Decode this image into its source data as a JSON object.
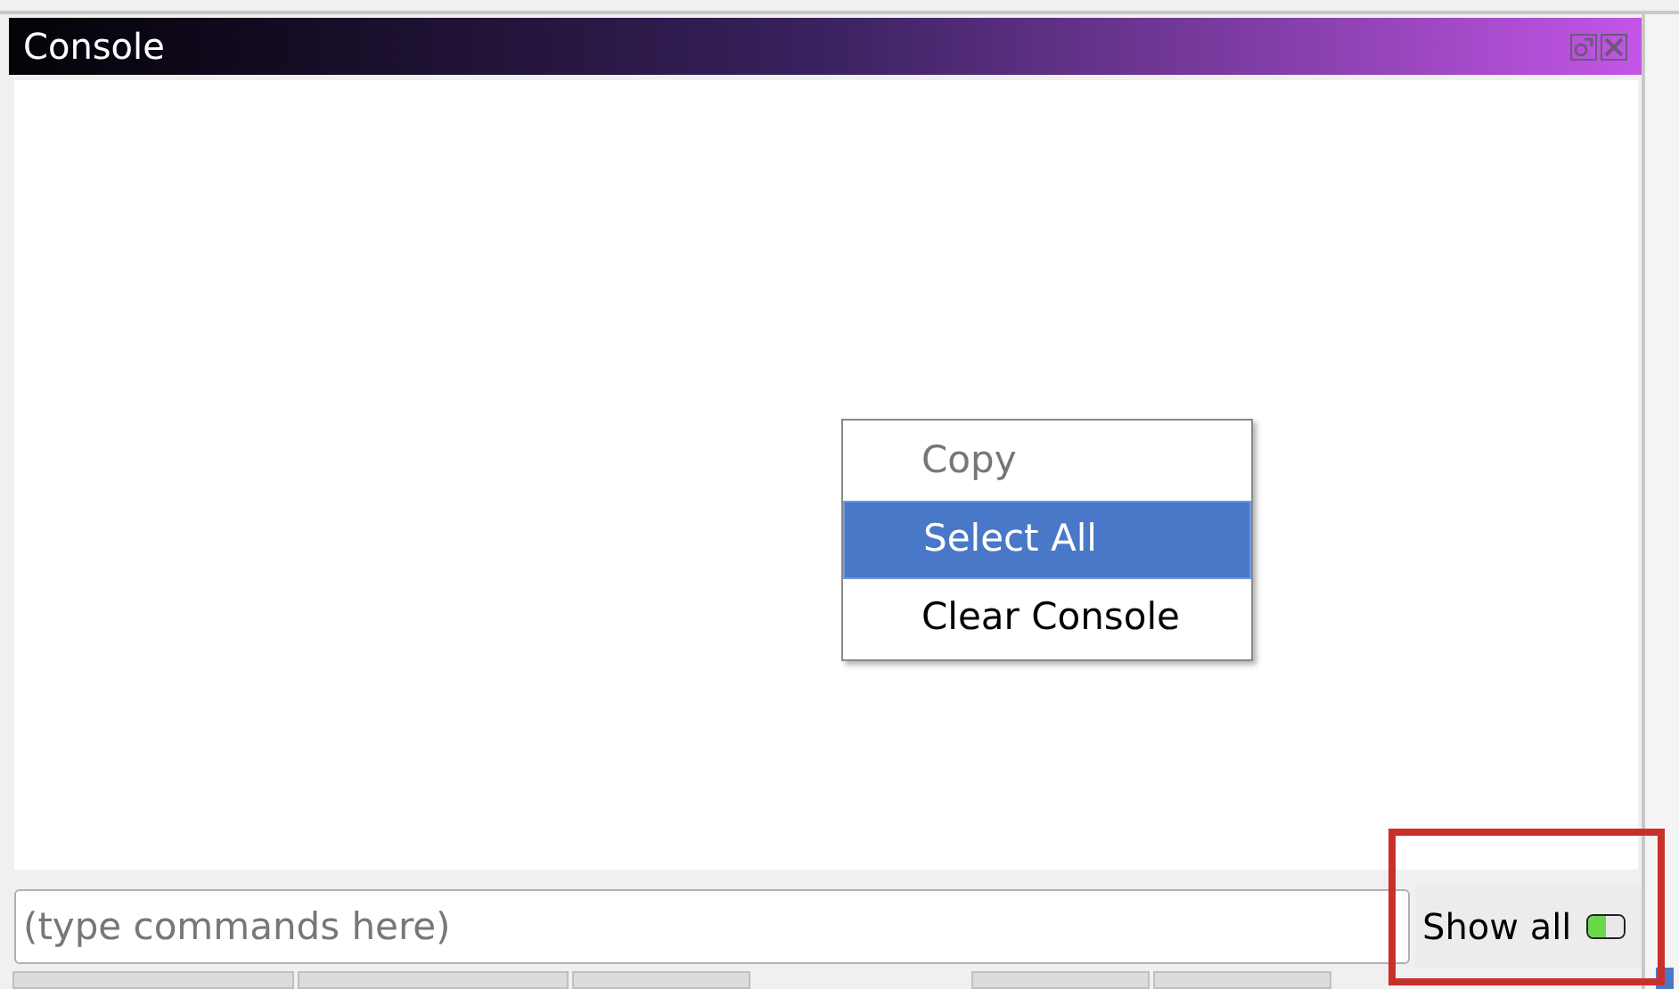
{
  "window": {
    "title": "Console"
  },
  "context_menu": {
    "items": [
      {
        "label": "Copy",
        "disabled": true,
        "selected": false
      },
      {
        "label": "Select All",
        "disabled": false,
        "selected": true
      },
      {
        "label": "Clear Console",
        "disabled": false,
        "selected": false
      }
    ]
  },
  "command_input": {
    "placeholder": "(type commands here)"
  },
  "show_all": {
    "label": "Show all",
    "on": true
  },
  "highlight": true
}
